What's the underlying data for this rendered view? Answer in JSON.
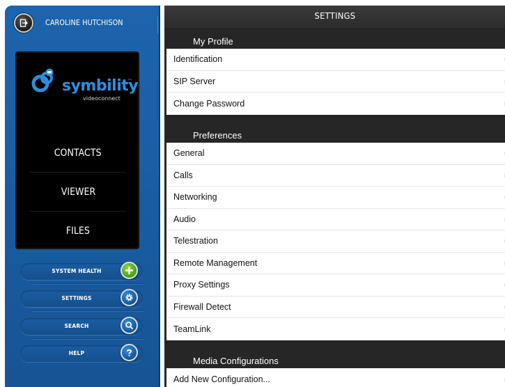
{
  "user": {
    "name": "CAROLINE HUTCHISON"
  },
  "logo": {
    "word": "symbility",
    "sub": "videoconnect",
    "tm": "™"
  },
  "nav": [
    {
      "label": "CONTACTS"
    },
    {
      "label": "VIEWER"
    },
    {
      "label": "FILES"
    }
  ],
  "tools": [
    {
      "label": "SYSTEM HEALTH",
      "icon": "plus-icon",
      "color": "#4fb020"
    },
    {
      "label": "SETTINGS",
      "icon": "gear-icon",
      "color": "#1a5ea6"
    },
    {
      "label": "SEARCH",
      "icon": "search-icon",
      "color": "#1a5ea6"
    },
    {
      "label": "HELP",
      "icon": "question-icon",
      "color": "#1a5ea6"
    }
  ],
  "settings": {
    "title": "SETTINGS",
    "sections": [
      {
        "title": "My Profile",
        "rows": [
          "Identification",
          "SIP Server",
          "Change Password"
        ]
      },
      {
        "title": "Preferences",
        "rows": [
          "General",
          "Calls",
          "Networking",
          "Audio",
          "Telestration",
          "Remote Management",
          "Proxy Settings",
          "Firewall Detect",
          "TeamLink"
        ]
      },
      {
        "title": "Media Configurations",
        "rows": [
          "Add New Configuration..."
        ]
      }
    ],
    "chevron": "›"
  },
  "colors": {
    "sidebar": "#1a5ea6",
    "panel": "#000000",
    "settings_bg": "#262626",
    "brand": "#2b8fe0"
  }
}
